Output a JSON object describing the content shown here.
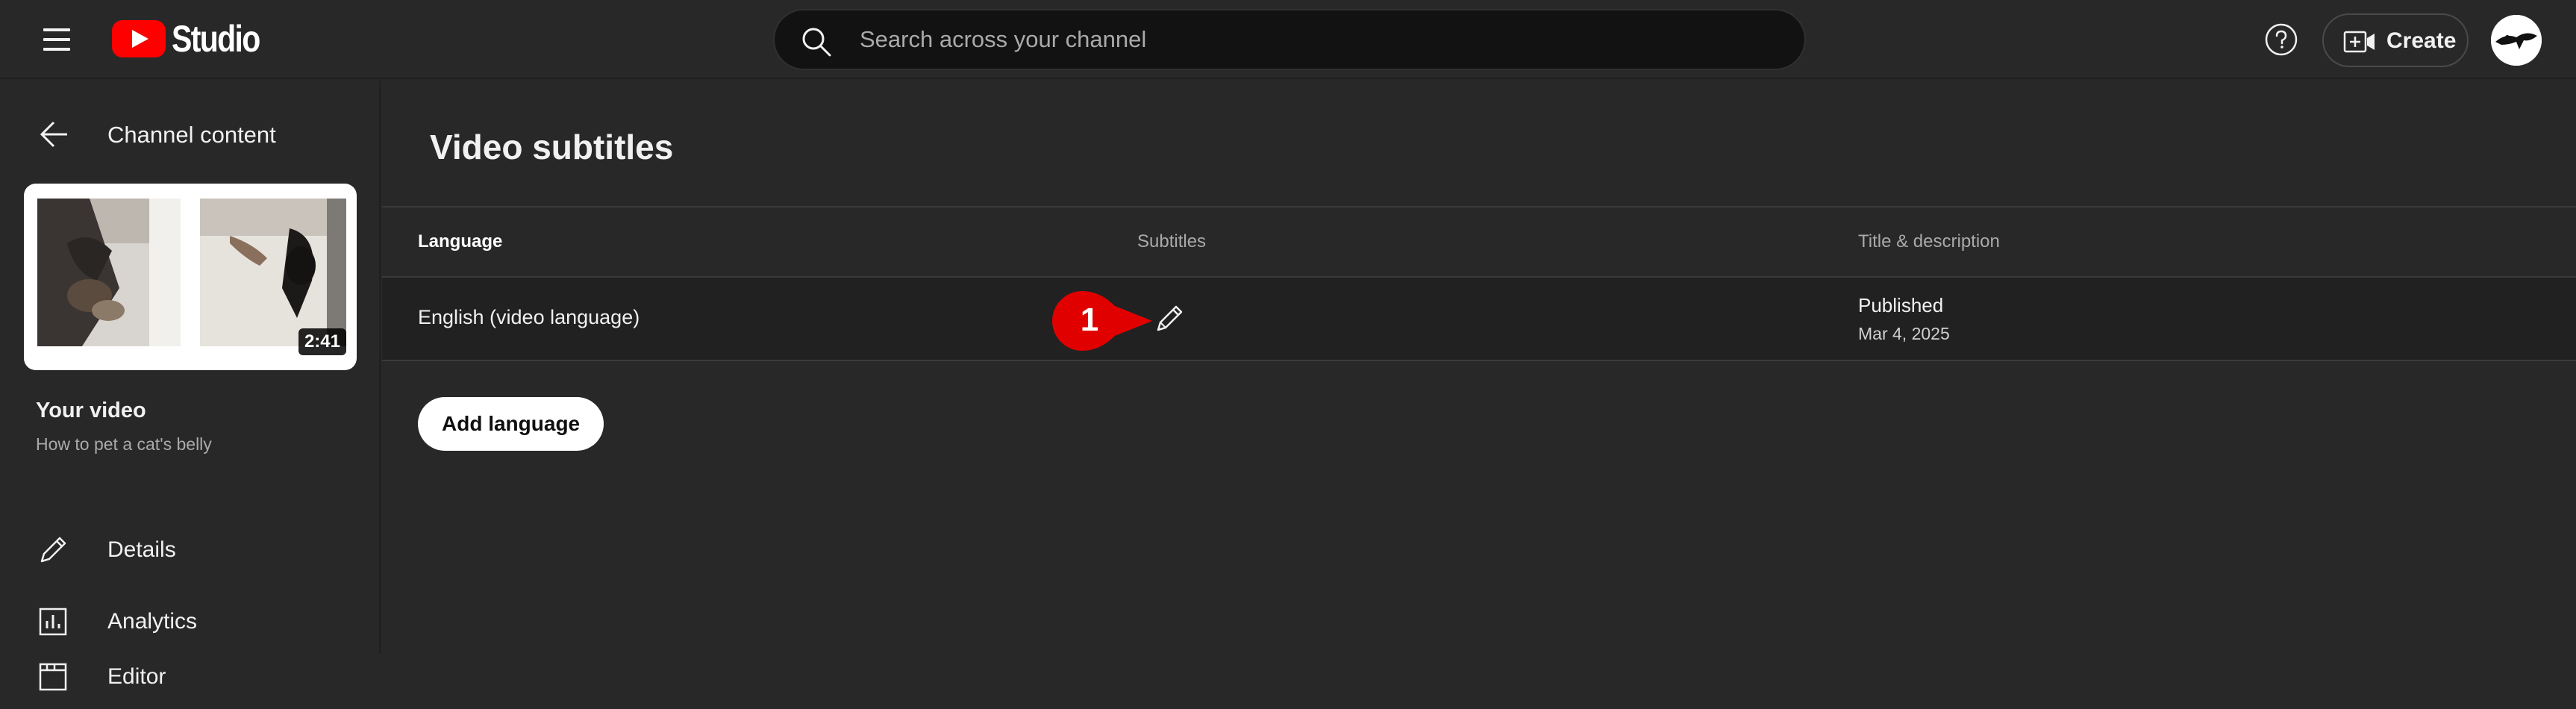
{
  "app": {
    "brand_name": "Studio",
    "brand_color": "#ff0000"
  },
  "header": {
    "search_placeholder": "Search across your channel",
    "create_label": "Create",
    "icons": [
      "menu-icon",
      "search-icon",
      "help-icon",
      "create-video-icon",
      "avatar"
    ]
  },
  "sidebar": {
    "back_label": "Channel content",
    "thumbnail_duration": "2:41",
    "your_video_label": "Your video",
    "video_title": "How to pet a cat's belly",
    "nav_items": [
      {
        "label": "Details",
        "icon": "pencil-icon"
      },
      {
        "label": "Analytics",
        "icon": "analytics-icon"
      },
      {
        "label": "Editor",
        "icon": "editor-icon"
      }
    ]
  },
  "main": {
    "page_title": "Video subtitles",
    "columns": [
      "Language",
      "Subtitles",
      "Title & description"
    ],
    "rows": [
      {
        "language": "English (video language)",
        "subtitles_action": "edit-icon",
        "status": "Published",
        "date": "Mar 4, 2025"
      }
    ],
    "callout_number": "1",
    "callout_color": "#e00000",
    "add_language_label": "Add language"
  }
}
